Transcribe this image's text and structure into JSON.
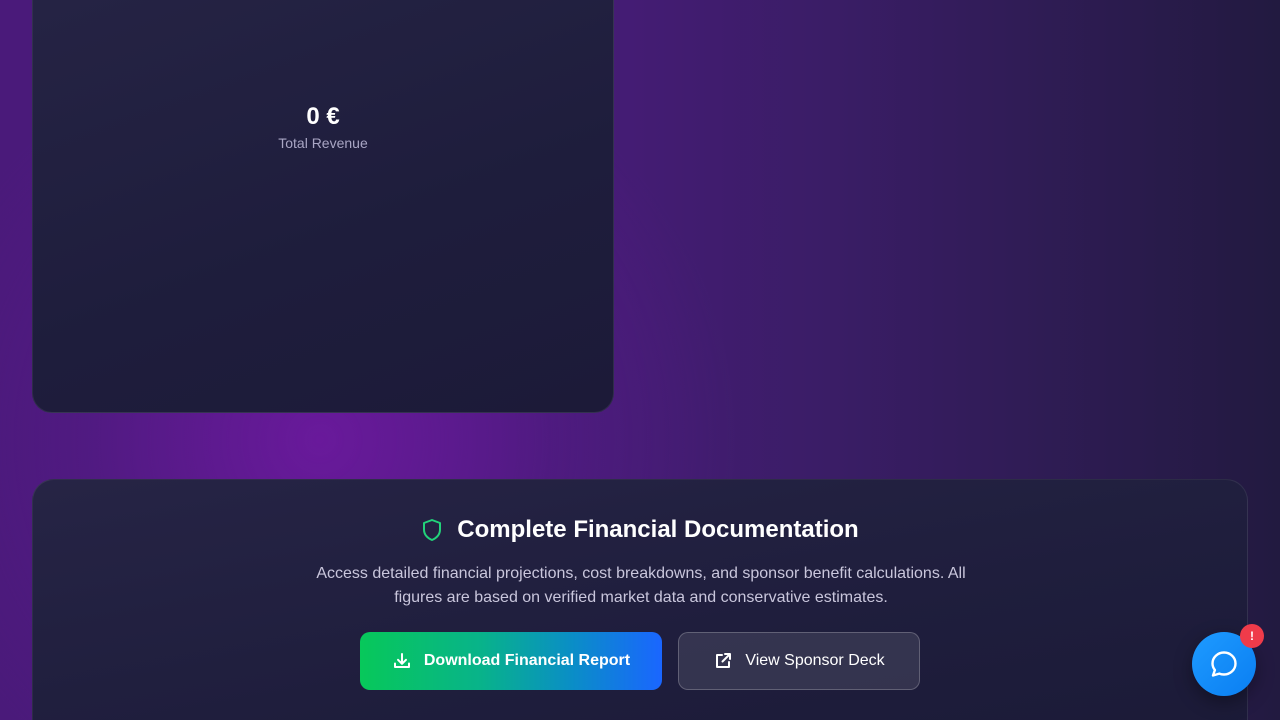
{
  "revenue_card": {
    "value": "0 €",
    "label": "Total Revenue"
  },
  "documentation": {
    "title": "Complete Financial Documentation",
    "description": "Access detailed financial projections, cost breakdowns, and sponsor benefit calculations. All figures are based on verified market data and conservative estimates.",
    "download_label": "Download Financial Report",
    "sponsor_label": "View Sponsor Deck",
    "icons": {
      "title": "shield-icon",
      "download": "download-icon",
      "sponsor": "external-link-icon"
    }
  },
  "chat": {
    "icon": "chat-bubble-icon",
    "badge": "!"
  },
  "colors": {
    "accent_green": "#07c85a",
    "accent_blue": "#1a66ff",
    "shield": "#22d27a",
    "chat_blue": "#1e9bff",
    "badge_red": "#ef3b4a"
  }
}
